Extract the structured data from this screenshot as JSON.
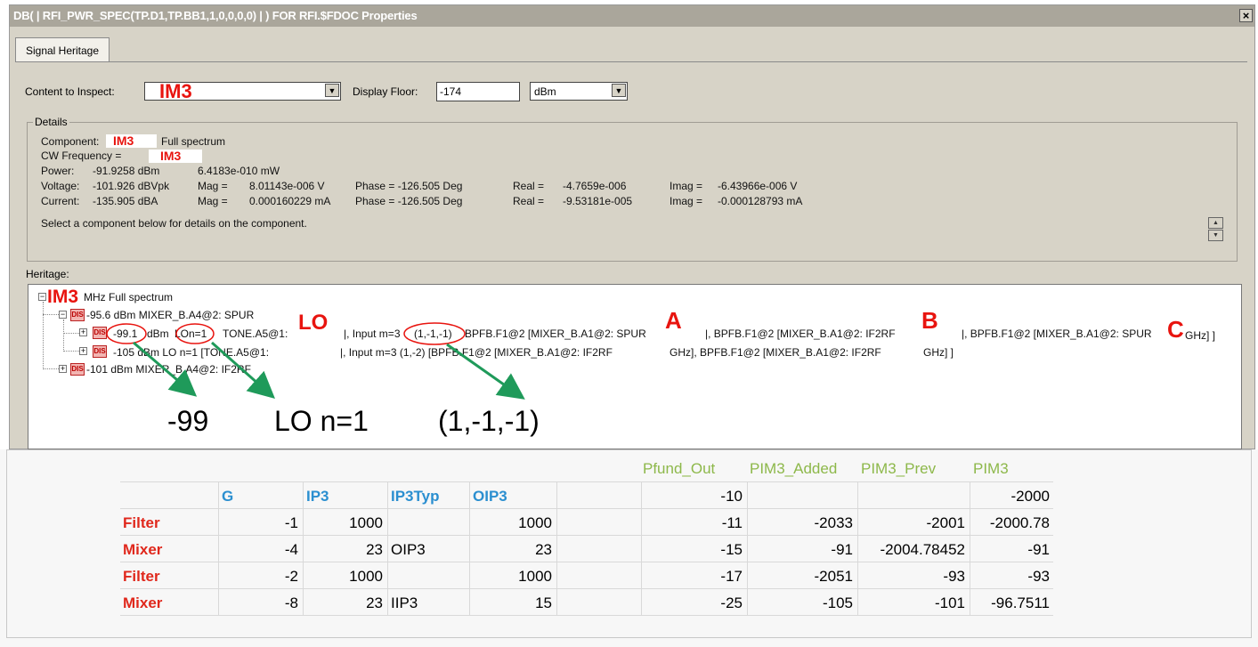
{
  "window": {
    "title": "DB( | RFI_PWR_SPEC(TP.D1,TP.BB1,1,0,0,0,0) | ) FOR RFI.$FDOC Properties",
    "close_glyph": "×"
  },
  "tab": {
    "label": "Signal Heritage"
  },
  "controls": {
    "content_label": "Content to Inspect:",
    "content_value": "IM3",
    "display_floor_label": "Display Floor:",
    "display_floor_value": "-174",
    "unit_value": "dBm"
  },
  "details": {
    "group_label": "Details",
    "component_label": "Component:",
    "component_value": "IM3",
    "component_suffix": "Full spectrum",
    "cw_label": "CW Frequency =",
    "cw_value": "IM3",
    "power_row": [
      "Power:",
      "-91.9258 dBm",
      "6.4183e-010 mW"
    ],
    "voltage_row": [
      "Voltage:",
      "-101.926 dBVpk",
      "Mag =",
      "8.01143e-006 V",
      "Phase = -126.505 Deg",
      "Real =",
      "-4.7659e-006",
      "Imag =",
      "-6.43966e-006 V"
    ],
    "current_row": [
      "Current:",
      "-135.905 dBA",
      "Mag =",
      "0.000160229 mA",
      "Phase = -126.505 Deg",
      "Real =",
      "-9.53181e-005",
      "Imag =",
      "-0.000128793 mA"
    ],
    "hint": "Select a component below for details on the component."
  },
  "heritage": {
    "label": "Heritage:",
    "root_prefix": "IM3",
    "root_text": "MHz Full spectrum",
    "node1": "-95.6 dBm MIXER_B.A4@2: SPUR",
    "node2_a": "-99.1",
    "node2_b": "dBm",
    "node2_c": "LO",
    "node2_d": "n=1",
    "node2_e": "TONE.A5@1:",
    "node2_f": "|, Input m=3",
    "node2_g": "(1,-1,-1)",
    "node2_h": "BPFB.F1@2 [MIXER_B.A1@2: SPUR",
    "node2_i": "|, BPFB.F1@2 [MIXER_B.A1@2: IF2RF",
    "node2_j": "|, BPFB.F1@2 [MIXER_B.A1@2: SPUR",
    "node2_k": "GHz] ]",
    "node3_a": "-105 dBm LO n=1 [TONE.A5@1:",
    "node3_b": "|, Input m=3 (1,-2) [BPFB.F1@2 [MIXER_B.A1@2: IF2RF",
    "node3_c": "GHz], BPFB.F1@2 [MIXER_B.A1@2: IF2RF",
    "node3_d": "GHz] ]",
    "node4": "-101 dBm MIXER_B.A4@2: IF2RF",
    "dis_tag": "DIS",
    "annotations": {
      "lo": "LO",
      "a": "A",
      "b": "B",
      "c": "C"
    },
    "callouts": [
      "-99",
      "LO n=1",
      "(1,-1,-1)"
    ]
  },
  "table": {
    "top_headers": [
      "Pfund_Out",
      "PIM3_Added",
      "PIM3_Prev",
      "PIM3"
    ],
    "col_headers": [
      "G",
      "IP3",
      "IP3Typ",
      "OIP3"
    ],
    "first_row": {
      "pfund": "-10",
      "pim3": "-2000"
    },
    "rows": [
      {
        "name": "Filter",
        "g": "-1",
        "ip3": "1000",
        "typ": "",
        "oip3": "1000",
        "pfund": "-11",
        "added": "-2033",
        "prev": "-2001",
        "pim3": "-2000.78"
      },
      {
        "name": "Mixer",
        "g": "-4",
        "ip3": "23",
        "typ": "OIP3",
        "oip3": "23",
        "pfund": "-15",
        "added": "-91",
        "prev": "-2004.78452",
        "pim3": "-91"
      },
      {
        "name": "Filter",
        "g": "-2",
        "ip3": "1000",
        "typ": "",
        "oip3": "1000",
        "pfund": "-17",
        "added": "-2051",
        "prev": "-93",
        "pim3": "-93"
      },
      {
        "name": "Mixer",
        "g": "-8",
        "ip3": "23",
        "typ": "IIP3",
        "oip3": "15",
        "pfund": "-25",
        "added": "-105",
        "prev": "-101",
        "pim3": "-96.7511"
      }
    ]
  },
  "colors": {
    "annotation_red": "#e8140f",
    "header_blue": "#2b8fd0",
    "header_green": "#8db84a",
    "window_bg": "#d7d3c7"
  }
}
